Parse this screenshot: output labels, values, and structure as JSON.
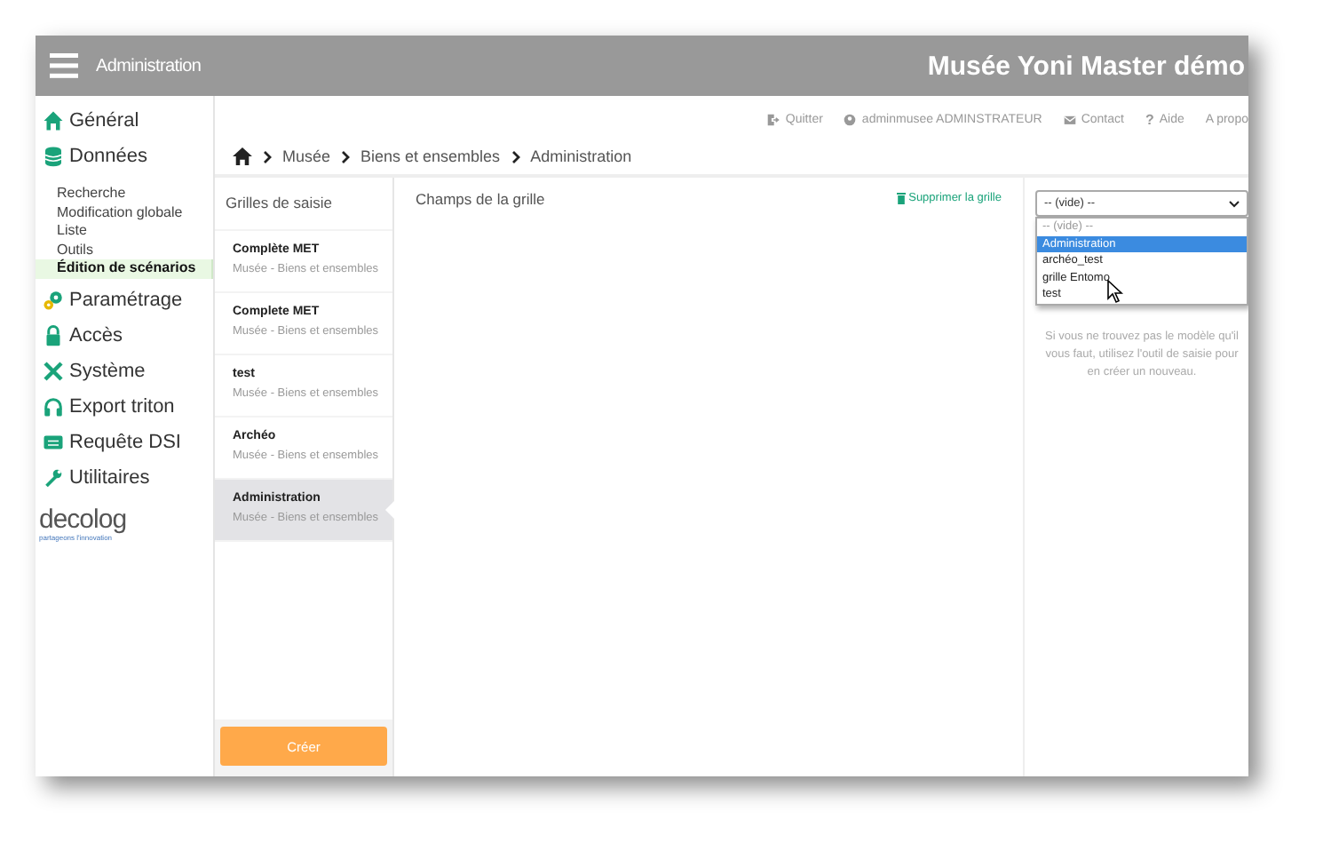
{
  "header": {
    "section": "Administration",
    "title": "Musée Yoni Master démo"
  },
  "sidebar": {
    "items": [
      {
        "label": "Général",
        "kind": "home"
      },
      {
        "label": "Données",
        "kind": "database",
        "children": [
          {
            "label": "Recherche",
            "selected": false
          },
          {
            "label": "Modification globale",
            "selected": false
          },
          {
            "label": "Liste",
            "selected": false
          },
          {
            "label": "Outils",
            "selected": false
          },
          {
            "label": "Édition de scénarios",
            "selected": true
          }
        ]
      },
      {
        "label": "Paramétrage",
        "kind": "gears"
      },
      {
        "label": "Accès",
        "kind": "lock"
      },
      {
        "label": "Système",
        "kind": "tools"
      },
      {
        "label": "Export triton",
        "kind": "headset"
      },
      {
        "label": "Requête DSI",
        "kind": "tray"
      },
      {
        "label": "Utilitaires",
        "kind": "wrench"
      }
    ],
    "logo": {
      "name": "decolog",
      "tagline": "partageons l'innovation"
    }
  },
  "top_links": [
    {
      "label": "Quitter",
      "kind": "exit"
    },
    {
      "label": "adminmusee ADMINSTRATEUR",
      "kind": "user"
    },
    {
      "label": "Contact",
      "kind": "mail"
    },
    {
      "label": "Aide",
      "kind": "help",
      "icon_text": "?"
    },
    {
      "label": "A propo",
      "kind": "plain"
    }
  ],
  "breadcrumb": [
    "Musée",
    "Biens et ensembles",
    "Administration"
  ],
  "grids": {
    "title": "Grilles de saisie",
    "items": [
      {
        "name": "Complète MET",
        "subtitle": "Musée - Biens et ensembles",
        "selected": false
      },
      {
        "name": "Complete MET",
        "subtitle": "Musée - Biens et ensembles",
        "selected": false
      },
      {
        "name": "test",
        "subtitle": "Musée - Biens et ensembles",
        "selected": false
      },
      {
        "name": "Archéo",
        "subtitle": "Musée - Biens et ensembles",
        "selected": false
      },
      {
        "name": "Administration",
        "subtitle": "Musée - Biens et ensembles",
        "selected": true
      }
    ],
    "create_button": "Créer"
  },
  "fields": {
    "title": "Champs de la grille",
    "delete_link": "Supprimer la grille"
  },
  "template": {
    "select_value": "-- (vide) --",
    "expanded": true,
    "options": [
      {
        "label": "-- (vide) --",
        "selected": false
      },
      {
        "label": "Administration",
        "selected": true
      },
      {
        "label": "archéo_test",
        "selected": false
      },
      {
        "label": "grille Entomo",
        "selected": false
      },
      {
        "label": "test",
        "selected": false
      }
    ],
    "hint": "Si vous ne trouvez pas le modèle qu'il vous faut, utilisez l'outil de saisie pour en créer un nouveau."
  }
}
